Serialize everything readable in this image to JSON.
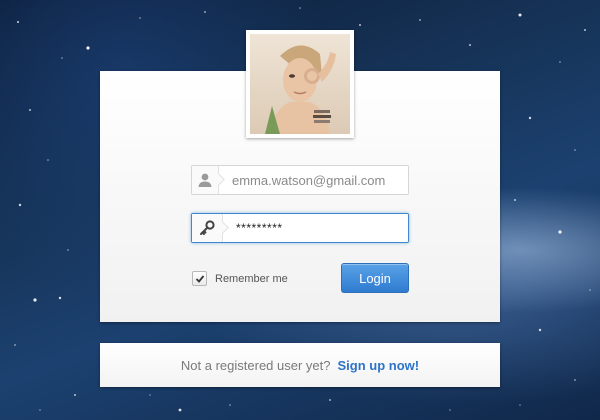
{
  "login": {
    "email_value": "emma.watson@gmail.com",
    "password_value": "*********",
    "remember_label": "Remember me",
    "remember_checked": true,
    "login_button_label": "Login"
  },
  "signup": {
    "prompt": "Not a registered user yet?",
    "link_label": "Sign up now!"
  },
  "icons": {
    "email_field": "user-icon",
    "password_field": "key-icon",
    "checkbox": "checkmark-icon"
  },
  "colors": {
    "accent": "#2f7bd0",
    "link": "#2c74c8",
    "focus_border": "#3f88cf"
  }
}
